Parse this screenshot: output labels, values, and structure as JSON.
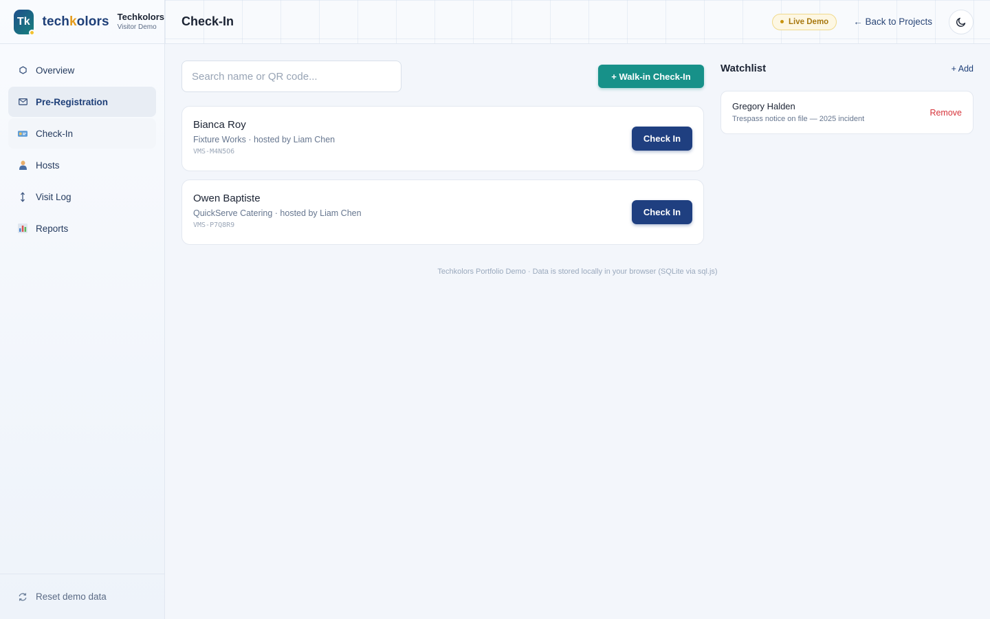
{
  "brand": {
    "badge": "Tk",
    "word_pre": "tech",
    "word_k": "k",
    "word_post": "olors",
    "name": "Techkolors",
    "subtitle": "Visitor Demo"
  },
  "nav": {
    "items": [
      {
        "label": "Overview",
        "icon": "hexagon-icon"
      },
      {
        "label": "Pre-Registration",
        "icon": "envelope-icon"
      },
      {
        "label": "Check-In",
        "icon": "id-card-icon"
      },
      {
        "label": "Hosts",
        "icon": "person-icon"
      },
      {
        "label": "Visit Log",
        "icon": "updown-arrow-icon"
      },
      {
        "label": "Reports",
        "icon": "bar-chart-icon"
      }
    ],
    "reset_label": "Reset demo data"
  },
  "header": {
    "title": "Check-In",
    "live_badge": "Live Demo",
    "back_link": "← Back to Projects"
  },
  "search": {
    "placeholder": "Search name or QR code..."
  },
  "walkin_label": "+ Walk-in Check-In",
  "visitors": [
    {
      "name": "Bianca Roy",
      "meta": "Fixture Works · hosted by Liam Chen",
      "code": "VMS-M4N5O6",
      "button": "Check In"
    },
    {
      "name": "Owen Baptiste",
      "meta": "QuickServe Catering · hosted by Liam Chen",
      "code": "VMS-P7Q8R9",
      "button": "Check In"
    }
  ],
  "watchlist": {
    "title": "Watchlist",
    "add_label": "+ Add",
    "items": [
      {
        "name": "Gregory Halden",
        "note": "Trespass notice on file — 2025 incident",
        "remove_label": "Remove"
      }
    ]
  },
  "footer_note": "Techkolors Portfolio Demo · Data is stored locally in your browser (SQLite via sql.js)",
  "colors": {
    "accent_teal": "#179189",
    "primary_navy": "#1f3f80",
    "danger": "#d6333a",
    "badge_gold": "#a8780f"
  }
}
